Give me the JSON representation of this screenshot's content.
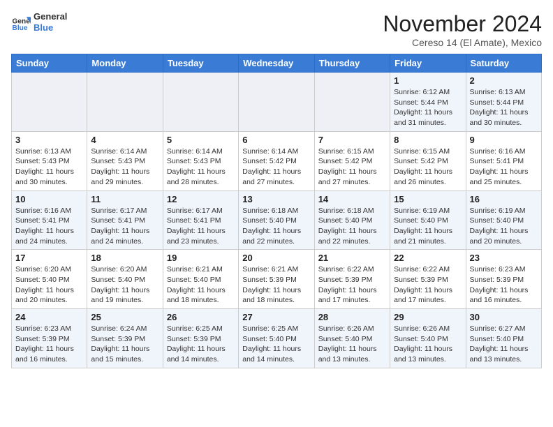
{
  "header": {
    "logo_general": "General",
    "logo_blue": "Blue",
    "month": "November 2024",
    "location": "Cereso 14 (El Amate), Mexico"
  },
  "days_of_week": [
    "Sunday",
    "Monday",
    "Tuesday",
    "Wednesday",
    "Thursday",
    "Friday",
    "Saturday"
  ],
  "weeks": [
    [
      {
        "day": "",
        "info": ""
      },
      {
        "day": "",
        "info": ""
      },
      {
        "day": "",
        "info": ""
      },
      {
        "day": "",
        "info": ""
      },
      {
        "day": "",
        "info": ""
      },
      {
        "day": "1",
        "info": "Sunrise: 6:12 AM\nSunset: 5:44 PM\nDaylight: 11 hours and 31 minutes."
      },
      {
        "day": "2",
        "info": "Sunrise: 6:13 AM\nSunset: 5:44 PM\nDaylight: 11 hours and 30 minutes."
      }
    ],
    [
      {
        "day": "3",
        "info": "Sunrise: 6:13 AM\nSunset: 5:43 PM\nDaylight: 11 hours and 30 minutes."
      },
      {
        "day": "4",
        "info": "Sunrise: 6:14 AM\nSunset: 5:43 PM\nDaylight: 11 hours and 29 minutes."
      },
      {
        "day": "5",
        "info": "Sunrise: 6:14 AM\nSunset: 5:43 PM\nDaylight: 11 hours and 28 minutes."
      },
      {
        "day": "6",
        "info": "Sunrise: 6:14 AM\nSunset: 5:42 PM\nDaylight: 11 hours and 27 minutes."
      },
      {
        "day": "7",
        "info": "Sunrise: 6:15 AM\nSunset: 5:42 PM\nDaylight: 11 hours and 27 minutes."
      },
      {
        "day": "8",
        "info": "Sunrise: 6:15 AM\nSunset: 5:42 PM\nDaylight: 11 hours and 26 minutes."
      },
      {
        "day": "9",
        "info": "Sunrise: 6:16 AM\nSunset: 5:41 PM\nDaylight: 11 hours and 25 minutes."
      }
    ],
    [
      {
        "day": "10",
        "info": "Sunrise: 6:16 AM\nSunset: 5:41 PM\nDaylight: 11 hours and 24 minutes."
      },
      {
        "day": "11",
        "info": "Sunrise: 6:17 AM\nSunset: 5:41 PM\nDaylight: 11 hours and 24 minutes."
      },
      {
        "day": "12",
        "info": "Sunrise: 6:17 AM\nSunset: 5:41 PM\nDaylight: 11 hours and 23 minutes."
      },
      {
        "day": "13",
        "info": "Sunrise: 6:18 AM\nSunset: 5:40 PM\nDaylight: 11 hours and 22 minutes."
      },
      {
        "day": "14",
        "info": "Sunrise: 6:18 AM\nSunset: 5:40 PM\nDaylight: 11 hours and 22 minutes."
      },
      {
        "day": "15",
        "info": "Sunrise: 6:19 AM\nSunset: 5:40 PM\nDaylight: 11 hours and 21 minutes."
      },
      {
        "day": "16",
        "info": "Sunrise: 6:19 AM\nSunset: 5:40 PM\nDaylight: 11 hours and 20 minutes."
      }
    ],
    [
      {
        "day": "17",
        "info": "Sunrise: 6:20 AM\nSunset: 5:40 PM\nDaylight: 11 hours and 20 minutes."
      },
      {
        "day": "18",
        "info": "Sunrise: 6:20 AM\nSunset: 5:40 PM\nDaylight: 11 hours and 19 minutes."
      },
      {
        "day": "19",
        "info": "Sunrise: 6:21 AM\nSunset: 5:40 PM\nDaylight: 11 hours and 18 minutes."
      },
      {
        "day": "20",
        "info": "Sunrise: 6:21 AM\nSunset: 5:39 PM\nDaylight: 11 hours and 18 minutes."
      },
      {
        "day": "21",
        "info": "Sunrise: 6:22 AM\nSunset: 5:39 PM\nDaylight: 11 hours and 17 minutes."
      },
      {
        "day": "22",
        "info": "Sunrise: 6:22 AM\nSunset: 5:39 PM\nDaylight: 11 hours and 17 minutes."
      },
      {
        "day": "23",
        "info": "Sunrise: 6:23 AM\nSunset: 5:39 PM\nDaylight: 11 hours and 16 minutes."
      }
    ],
    [
      {
        "day": "24",
        "info": "Sunrise: 6:23 AM\nSunset: 5:39 PM\nDaylight: 11 hours and 16 minutes."
      },
      {
        "day": "25",
        "info": "Sunrise: 6:24 AM\nSunset: 5:39 PM\nDaylight: 11 hours and 15 minutes."
      },
      {
        "day": "26",
        "info": "Sunrise: 6:25 AM\nSunset: 5:39 PM\nDaylight: 11 hours and 14 minutes."
      },
      {
        "day": "27",
        "info": "Sunrise: 6:25 AM\nSunset: 5:40 PM\nDaylight: 11 hours and 14 minutes."
      },
      {
        "day": "28",
        "info": "Sunrise: 6:26 AM\nSunset: 5:40 PM\nDaylight: 11 hours and 13 minutes."
      },
      {
        "day": "29",
        "info": "Sunrise: 6:26 AM\nSunset: 5:40 PM\nDaylight: 11 hours and 13 minutes."
      },
      {
        "day": "30",
        "info": "Sunrise: 6:27 AM\nSunset: 5:40 PM\nDaylight: 11 hours and 13 minutes."
      }
    ]
  ]
}
